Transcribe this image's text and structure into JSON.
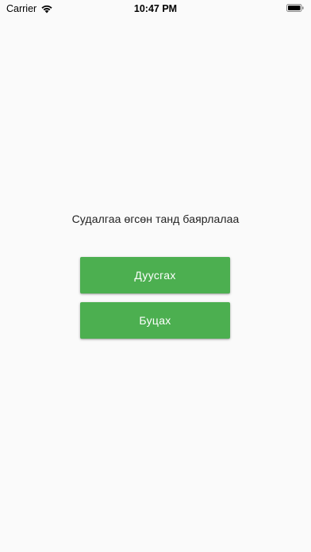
{
  "status_bar": {
    "carrier": "Carrier",
    "time": "10:47 PM",
    "wifi_icon": "wifi-icon",
    "battery_icon": "battery-icon"
  },
  "main": {
    "message": "Судалгаа өгсөн танд баярлалаа",
    "finish_button": "Дуусгах",
    "back_button": "Буцах"
  },
  "colors": {
    "background": "#fafafa",
    "button": "#4caf50",
    "button_text": "#ffffff"
  }
}
